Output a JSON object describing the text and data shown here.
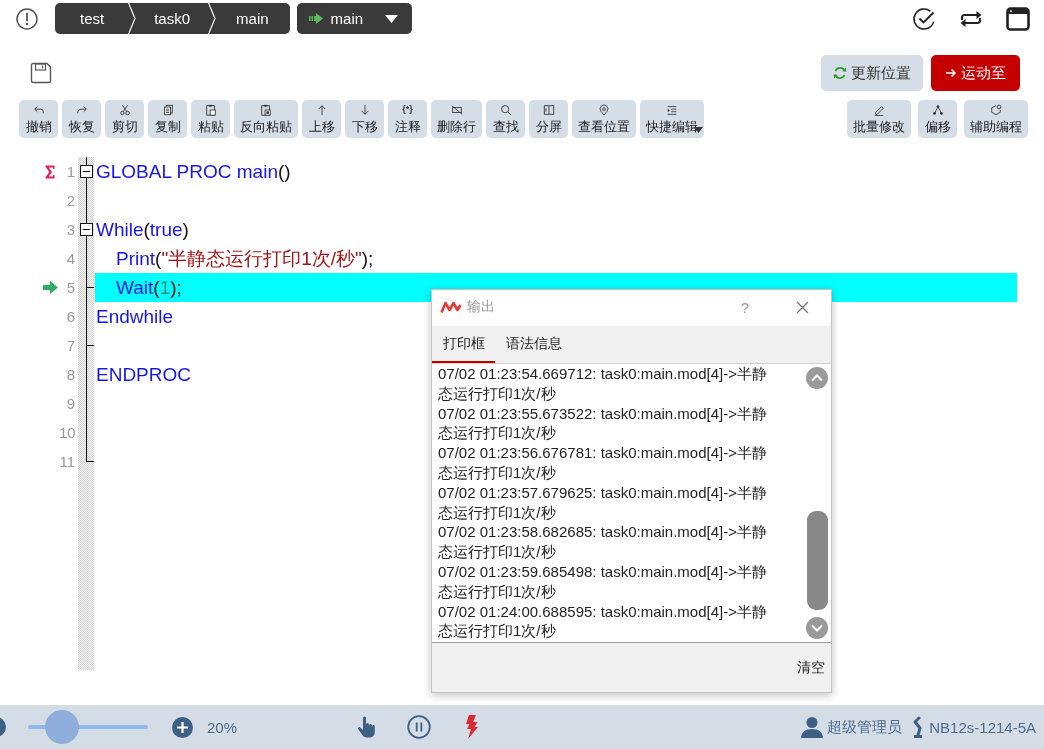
{
  "topbar": {
    "breadcrumb": [
      {
        "label": "test"
      },
      {
        "label": "task0"
      },
      {
        "label": "main"
      }
    ],
    "task_selector": {
      "label": "main"
    }
  },
  "actions": [
    {
      "kind": "refresh",
      "label": "更新位置"
    },
    {
      "kind": "move",
      "label": "运动至"
    }
  ],
  "toolbar": {
    "left": [
      {
        "label": "撤销",
        "dropdown": false
      },
      {
        "label": "恢复",
        "dropdown": false
      },
      {
        "label": "剪切",
        "dropdown": false
      },
      {
        "label": "复制",
        "dropdown": false
      },
      {
        "label": "粘贴",
        "dropdown": false
      },
      {
        "label": "反向粘贴",
        "dropdown": false
      },
      {
        "label": "上移",
        "dropdown": false
      },
      {
        "label": "下移",
        "dropdown": false
      },
      {
        "label": "注释",
        "glyph": "{*}",
        "dropdown": false
      },
      {
        "label": "删除行",
        "dropdown": false
      },
      {
        "label": "查找",
        "dropdown": false
      },
      {
        "label": "分屏",
        "dropdown": false
      },
      {
        "label": "查看位置",
        "dropdown": false
      },
      {
        "label": "快捷编辑",
        "dropdown": true
      }
    ],
    "right": [
      {
        "label": "批量修改",
        "dropdown": false
      },
      {
        "label": "偏移",
        "dropdown": false
      },
      {
        "label": "辅助编程",
        "dropdown": false
      }
    ]
  },
  "editor": {
    "lines": [
      {
        "number": "1",
        "entry": true,
        "current": false,
        "collapsible": true,
        "fold_end": false,
        "tokens": [
          {
            "kind": "keyword",
            "text": "GLOBAL PROC main"
          },
          {
            "kind": "plain",
            "text": "()"
          }
        ]
      },
      {
        "number": "2",
        "entry": false,
        "current": false,
        "collapsible": false,
        "fold_end": false
      },
      {
        "number": "3",
        "entry": false,
        "current": false,
        "collapsible": true,
        "fold_end": false,
        "tokens": [
          {
            "kind": "keyword",
            "text": "While"
          },
          {
            "kind": "plain",
            "text": "("
          },
          {
            "kind": "keyword",
            "text": "true"
          },
          {
            "kind": "plain",
            "text": ")"
          }
        ],
        "children": [
          {
            "number": "4",
            "entry": false,
            "current": false,
            "collapsible": false,
            "fold_end": false,
            "tokens": [
              {
                "kind": "keyword",
                "text": "Print"
              },
              {
                "kind": "plain",
                "text": "("
              },
              {
                "kind": "string",
                "text": "\"半静态运行打印1次/秒\""
              },
              {
                "kind": "plain",
                "text": ");"
              }
            ]
          },
          {
            "number": "5",
            "entry": false,
            "current": true,
            "collapsible": false,
            "fold_end": true,
            "tokens": [
              {
                "kind": "keyword",
                "text": "Wait"
              },
              {
                "kind": "plain",
                "text": "("
              },
              {
                "kind": "number",
                "text": "1"
              },
              {
                "kind": "plain",
                "text": ");"
              }
            ]
          }
        ]
      },
      {
        "number": "6",
        "entry": false,
        "current": false,
        "collapsible": false,
        "fold_end": false,
        "tokens": [
          {
            "kind": "keyword",
            "text": "Endwhile"
          }
        ]
      },
      {
        "number": "7",
        "entry": false,
        "current": false,
        "collapsible": false,
        "fold_end": true
      },
      {
        "number": "8",
        "entry": false,
        "current": false,
        "collapsible": false,
        "fold_end": false,
        "tokens": [
          {
            "kind": "keyword",
            "text": "ENDPROC"
          }
        ]
      },
      {
        "number": "9",
        "entry": false,
        "current": false,
        "collapsible": false,
        "fold_end": false
      },
      {
        "number": "10",
        "entry": false,
        "current": false,
        "collapsible": false,
        "fold_end": false
      },
      {
        "number": "11",
        "entry": false,
        "current": false,
        "collapsible": false,
        "fold_end": true
      }
    ]
  },
  "output": {
    "title": "输出",
    "help": "?",
    "tabs": [
      {
        "label": "打印框",
        "selected": true
      },
      {
        "label": "语法信息",
        "selected": false
      }
    ],
    "log": [
      "07/02 01:23:54.669712: task0:main.mod[4]->半静态运行打印1次/秒",
      "07/02 01:23:55.673522: task0:main.mod[4]->半静态运行打印1次/秒",
      "07/02 01:23:56.676781: task0:main.mod[4]->半静态运行打印1次/秒",
      "07/02 01:23:57.679625: task0:main.mod[4]->半静态运行打印1次/秒",
      "07/02 01:23:58.682685: task0:main.mod[4]->半静态运行打印1次/秒",
      "07/02 01:23:59.685498: task0:main.mod[4]->半静态运行打印1次/秒",
      "07/02 01:24:00.688595: task0:main.mod[4]->半静态运行打印1次/秒"
    ],
    "clear": "清空"
  },
  "statusbar": {
    "zoom": {
      "level": 0.2,
      "reading": "20%"
    },
    "user": "超级管理员",
    "robot": "NB12s-1214-5A"
  }
}
